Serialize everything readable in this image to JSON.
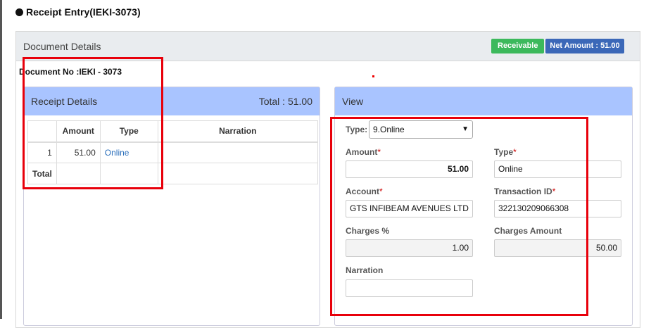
{
  "page": {
    "title": "Receipt Entry(IEKI-3073)"
  },
  "document": {
    "header": "Document Details",
    "badge_receivable": "Receivable",
    "badge_net_amount": "Net Amount :  51.00",
    "doc_no": "Document No :IEKI - 3073"
  },
  "receipt": {
    "title": "Receipt Details",
    "total": "Total :  51.00",
    "columns": [
      "",
      "Amount",
      "Type",
      "Narration"
    ],
    "rows": [
      {
        "no": "1",
        "amount": "51.00",
        "type": "Online",
        "narration": ""
      }
    ],
    "total_label": "Total"
  },
  "view": {
    "title": "View",
    "type_label": "Type:",
    "type_value": "9.Online",
    "amount_label": "Amount",
    "amount_value": "51.00",
    "type2_label": "Type",
    "type2_value": "Online",
    "account_label": "Account",
    "account_value": "GTS INFIBEAM AVENUES LTD",
    "txn_label": "Transaction ID",
    "txn_value": "322130209066308",
    "charges_pct_label": "Charges %",
    "charges_pct_value": "1.00",
    "charges_amt_label": "Charges Amount",
    "charges_amt_value": "50.00",
    "narration_label": "Narration",
    "narration_value": "",
    "required_mark": "*"
  },
  "colors": {
    "receivable": "#3cb95c",
    "net_amount": "#3b68b8",
    "card_header": "#a9c4ff",
    "highlight": "#e8000b"
  },
  "icons": {
    "title_bullet": "circle-bullet",
    "select_chevron": "chevron-down"
  }
}
